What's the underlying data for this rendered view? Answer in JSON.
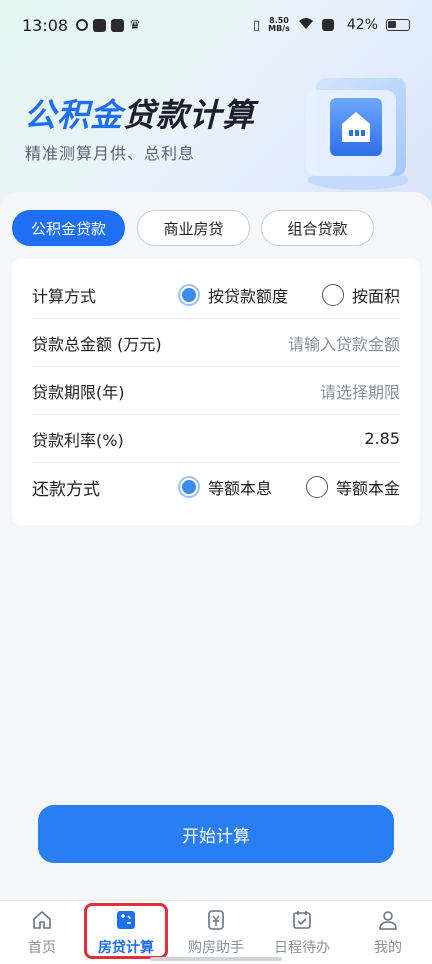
{
  "status_bar": {
    "time": "13:08",
    "net_speed_value": "8.50",
    "net_speed_unit": "MB/s",
    "battery": "42%"
  },
  "hero": {
    "title_part1": "公积金",
    "title_part2": "贷款计算",
    "subtitle": "精准测算月供、总利息"
  },
  "tabs": [
    {
      "label": "公积金贷款",
      "active": true
    },
    {
      "label": "商业房贷",
      "active": false
    },
    {
      "label": "组合贷款",
      "active": false
    }
  ],
  "form": {
    "calc_method": {
      "label": "计算方式",
      "options": [
        "按贷款额度",
        "按面积"
      ],
      "selected": "按贷款额度"
    },
    "loan_amount": {
      "label": "贷款总金额 (万元)",
      "placeholder": "请输入贷款金额"
    },
    "loan_term": {
      "label": "贷款期限(年)",
      "placeholder": "请选择期限"
    },
    "interest_rate": {
      "label": "贷款利率(%)",
      "value": "2.85"
    },
    "repayment": {
      "label": "还款方式",
      "options": [
        "等额本息",
        "等额本金"
      ],
      "selected": "等额本息"
    }
  },
  "start_button": "开始计算",
  "bottom_nav": [
    {
      "label": "首页",
      "icon": "home-icon",
      "active": false
    },
    {
      "label": "房贷计算",
      "icon": "calculator-icon",
      "active": true
    },
    {
      "label": "购房助手",
      "icon": "yuan-icon",
      "active": false
    },
    {
      "label": "日程待办",
      "icon": "calendar-icon",
      "active": false
    },
    {
      "label": "我的",
      "icon": "person-icon",
      "active": false
    }
  ],
  "colors": {
    "accent": "#1f6ff5",
    "button": "#2a7ef4",
    "highlight_border": "#e0303a"
  }
}
